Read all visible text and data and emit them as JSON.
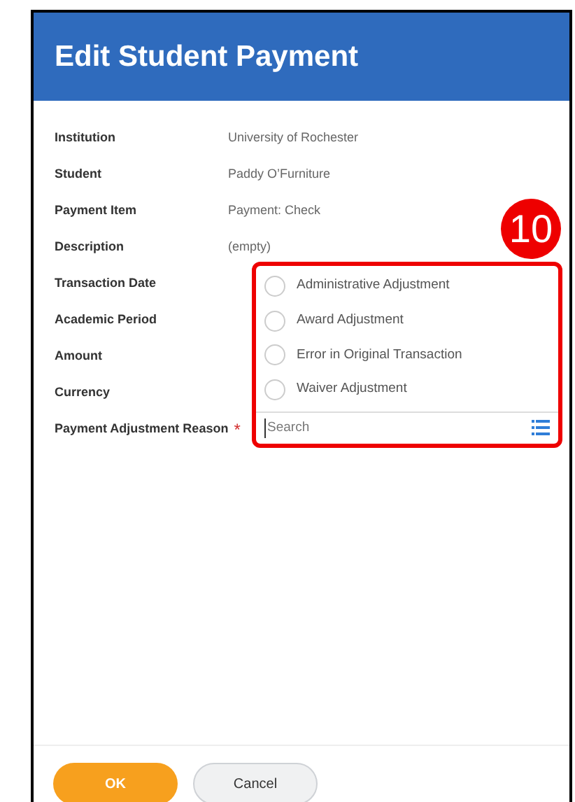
{
  "window": {
    "title": "Edit Student Payment"
  },
  "fields": [
    {
      "label": "Institution",
      "value": "University of Rochester"
    },
    {
      "label": "Student",
      "value": "Paddy O’Furniture"
    },
    {
      "label": "Payment Item",
      "value": "Payment: Check"
    },
    {
      "label": "Description",
      "value": "(empty)"
    },
    {
      "label": "Transaction Date"
    },
    {
      "label": "Academic Period"
    },
    {
      "label": "Amount"
    },
    {
      "label": "Currency"
    },
    {
      "label": "Payment Adjustment Reason",
      "required_mark": "*"
    }
  ],
  "dropdown": {
    "options": [
      {
        "label": "Administrative Adjustment",
        "selected": false
      },
      {
        "label": "Award Adjustment",
        "selected": false
      },
      {
        "label": "Error in Original Transaction",
        "selected": false
      },
      {
        "label": "Waiver Adjustment",
        "selected": false
      }
    ],
    "search": {
      "placeholder": "Search"
    }
  },
  "annotation": {
    "number": "10"
  },
  "buttons": [
    {
      "label": "OK",
      "kind": "primary"
    },
    {
      "label": "Cancel",
      "kind": "secondary"
    }
  ]
}
